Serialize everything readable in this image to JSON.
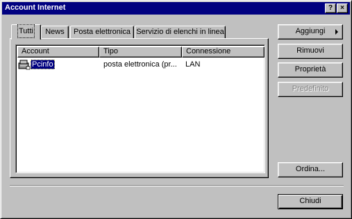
{
  "window": {
    "title": "Account Internet",
    "help_label": "?",
    "close_label": "×"
  },
  "tabs": [
    {
      "label": "Tutti",
      "active": true
    },
    {
      "label": "News",
      "active": false
    },
    {
      "label": "Posta elettronica",
      "active": false
    },
    {
      "label": "Servizio di elenchi in linea",
      "active": false
    }
  ],
  "list": {
    "columns": [
      "Account",
      "Tipo",
      "Connessione"
    ],
    "rows": [
      {
        "account": "Pcinfo",
        "tipo": "posta elettronica (pr...",
        "connessione": "LAN",
        "icon": "mail-server-icon",
        "selected": true
      }
    ]
  },
  "buttons": {
    "aggiungi": "Aggiungi",
    "rimuovi": "Rimuovi",
    "proprieta": "Proprietà",
    "predefinito": "Predefinito",
    "ordina": "Ordina...",
    "chiudi": "Chiudi"
  },
  "colors": {
    "titlebar": "#000080",
    "face": "#c0c0c0",
    "selection": "#000080"
  }
}
